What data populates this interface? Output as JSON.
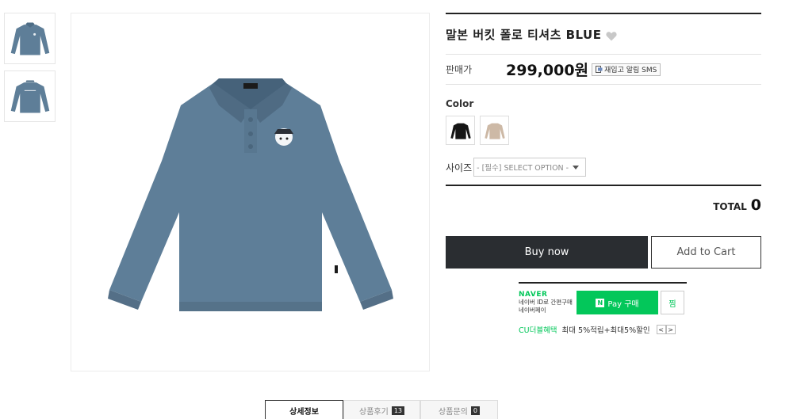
{
  "product": {
    "title": "말본 버킷 폴로 티셔츠 BLUE",
    "price_label": "판매가",
    "price": "299,000원",
    "restock_label": "재입고 알림 SMS",
    "color_label": "Color",
    "colors": [
      {
        "name": "black",
        "hex": "#151515"
      },
      {
        "name": "beige",
        "hex": "#cdb9a6"
      }
    ],
    "main_color": "#5e7e98",
    "size_label": "사이즈",
    "size_placeholder": "- [필수] SELECT OPTION -",
    "total_label": "TOTAL",
    "total_value": "0",
    "buy_label": "Buy now",
    "cart_label": "Add to Cart"
  },
  "naver_pay": {
    "logo": "NAVER",
    "desc_line1": "네이버 ID로 간편구매",
    "desc_line2": "네이버페이",
    "pay_label": "Pay 구매",
    "wish_label": "찜",
    "benefit_label": "CU더블혜택",
    "benefit_text": "최대 5%적립+최대5%할인",
    "prev_icon": "<",
    "next_icon": ">"
  },
  "tabs": [
    {
      "label": "상세정보"
    },
    {
      "label": "상품후기",
      "count": "13"
    },
    {
      "label": "상품문의",
      "count": "0"
    }
  ],
  "icons": {
    "heart": "heart-icon",
    "sms": "bell-icon",
    "n_logo": "N",
    "caret": "chevron-down-icon"
  }
}
